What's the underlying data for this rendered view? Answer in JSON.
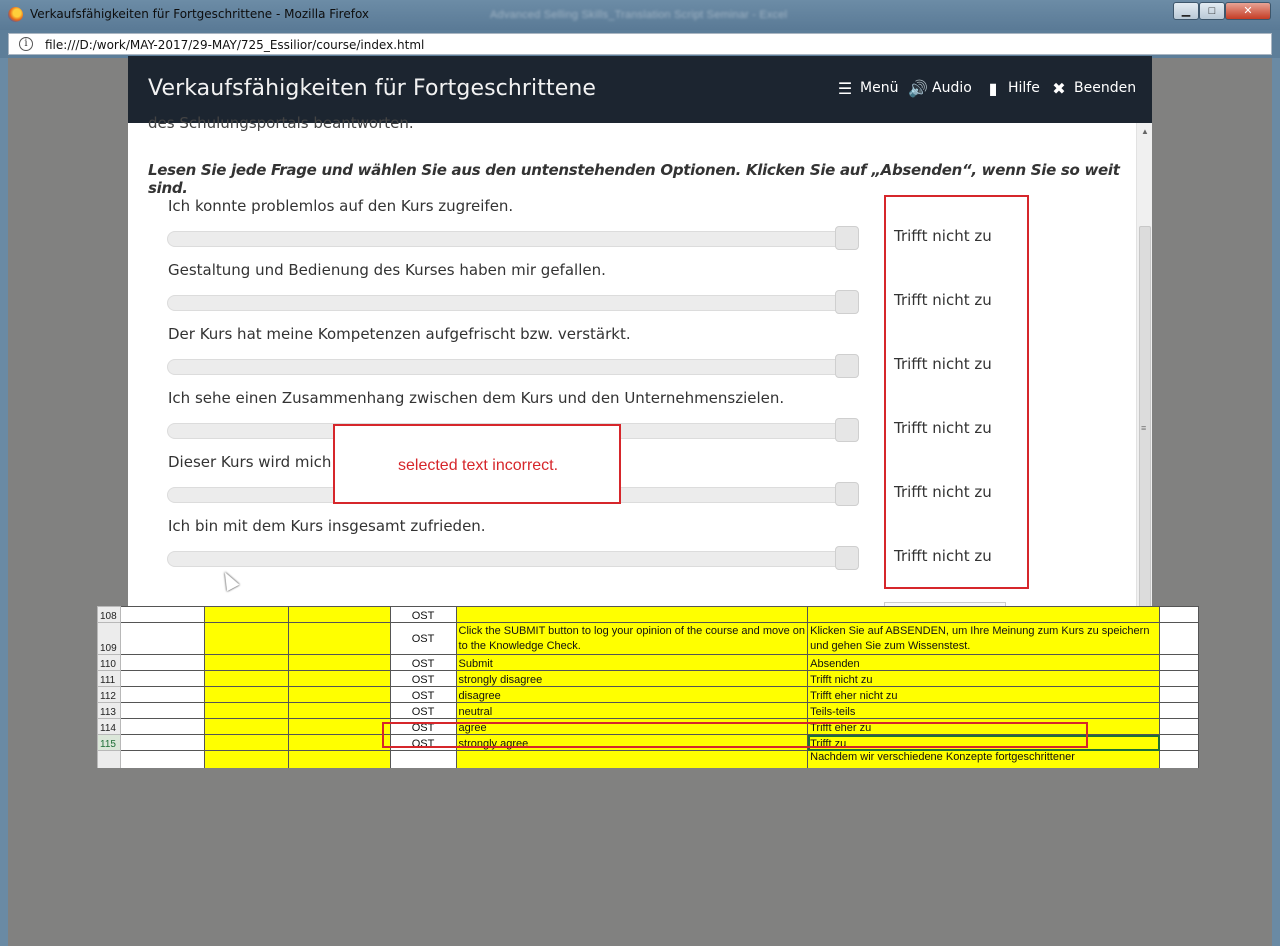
{
  "window": {
    "title": "Verkaufsfähigkeiten für Fortgeschrittene - Mozilla Firefox",
    "background_title": "Advanced Selling Skills_Translation Script Seminar - Excel",
    "minimize": "▁",
    "maximize": "□",
    "close": "✕"
  },
  "address": {
    "url": "file:///D:/work/MAY-2017/29-MAY/725_Essilior/course/index.html",
    "info": "i"
  },
  "course": {
    "title": "Verkaufsfähigkeiten für Fortgeschrittene",
    "menu_label": "Menü",
    "audio_label": "Audio",
    "help_label": "Hilfe",
    "exit_label": "Beenden",
    "cut_text": "des Schulungsportals beantworten.",
    "instruction": "Lesen Sie jede Frage und wählen Sie aus den untenstehenden Optionen. Klicken Sie auf „Absenden“, wenn Sie so weit sind.",
    "questions": [
      {
        "text": "Ich konnte problemlos auf den Kurs zugreifen.",
        "answer": "Trifft nicht zu"
      },
      {
        "text": "Gestaltung und Bedienung des Kurses haben mir gefallen.",
        "answer": "Trifft nicht zu"
      },
      {
        "text": "Der Kurs hat meine Kompetenzen aufgefrischt bzw. verstärkt.",
        "answer": "Trifft nicht zu"
      },
      {
        "text": "Ich sehe einen Zusammenhang zwischen dem Kurs und den Unternehmenszielen.",
        "answer": "Trifft nicht zu"
      },
      {
        "text": "Dieser Kurs wird mich in",
        "answer": "Trifft nicht zu"
      },
      {
        "text": "Ich bin mit dem Kurs insgesamt zufrieden.",
        "answer": "Trifft nicht zu"
      }
    ],
    "callout": "selected text incorrect."
  },
  "sheet": {
    "rows": [
      {
        "num": "108",
        "type": "OST",
        "en": "",
        "de": ""
      },
      {
        "num": "109",
        "type": "OST",
        "en": "Click the SUBMIT button to log your opinion of the course and move on to the Knowledge Check.",
        "de": "Klicken Sie auf ABSENDEN, um Ihre Meinung zum Kurs zu speichern und gehen Sie zum Wissenstest."
      },
      {
        "num": "110",
        "type": "OST",
        "en": "Submit",
        "de": "Absenden"
      },
      {
        "num": "111",
        "type": "OST",
        "en": "strongly disagree",
        "de": "Trifft nicht zu"
      },
      {
        "num": "112",
        "type": "OST",
        "en": "disagree",
        "de": "Trifft eher nicht zu"
      },
      {
        "num": "113",
        "type": "OST",
        "en": "neutral",
        "de": "Teils-teils"
      },
      {
        "num": "114",
        "type": "OST",
        "en": "agree",
        "de": "Trifft eher zu"
      },
      {
        "num": "115",
        "type": "OST",
        "en": "strongly agree",
        "de": "Trifft zu"
      },
      {
        "num": "",
        "type": "",
        "en": "",
        "de": "Nachdem wir verschiedene Konzepte fortgeschrittener"
      }
    ]
  },
  "colors": {
    "header_bg": "#1c2530",
    "annotation_red": "#d6262b",
    "sheet_yellow": "#ffff00"
  }
}
